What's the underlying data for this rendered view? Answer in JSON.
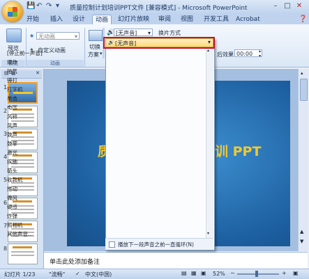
{
  "window": {
    "title": "质量控制计划培训PPT文件 [兼容模式] - Microsoft PowerPoint"
  },
  "tabs": [
    "开始",
    "插入",
    "设计",
    "动画",
    "幻灯片放映",
    "审阅",
    "视图",
    "开发工具",
    "Acrobat"
  ],
  "active_tab": "动画",
  "ribbon": {
    "preview_label": "预览",
    "preview_group_label": "预览",
    "animation_select_value": "无动画",
    "custom_animation_label": "自定义动画",
    "animation_group_label": "动画",
    "switch_scheme_label_1": "切换",
    "switch_scheme_label_2": "方案",
    "sound_select_value": "[无声音]",
    "switch_mode_label": "换片方式",
    "auto_switch_label": "后效果:",
    "auto_switch_time": "00:00"
  },
  "sound_dropdown": {
    "selected": "[无声音]",
    "items": [
      "[停止前一声音]",
      "爆炸",
      "抽气",
      "锤打",
      "打字机",
      "单击",
      "电压",
      "风铃",
      "风声",
      "鼓声",
      "鼓掌",
      "激光",
      "疾驰",
      "箭头",
      "收款机",
      "推动",
      "微风",
      "硬币",
      "炸弹",
      "照相机",
      "其他声音..."
    ],
    "footer_option": "播放下一段声音之前一直循环(N)"
  },
  "slides": {
    "numbers": [
      "1",
      "2",
      "3",
      "4",
      "5",
      "6",
      "7",
      "8"
    ],
    "main_title": "质        训 PPT",
    "main_title_left": "质",
    "main_title_right": "训 PPT"
  },
  "notes": {
    "placeholder": "单击此处添加备注"
  },
  "status": {
    "slide_info": "幻灯片 1/23",
    "theme": "\"流畅\"",
    "language": "中文(中国)",
    "zoom": "52%"
  }
}
